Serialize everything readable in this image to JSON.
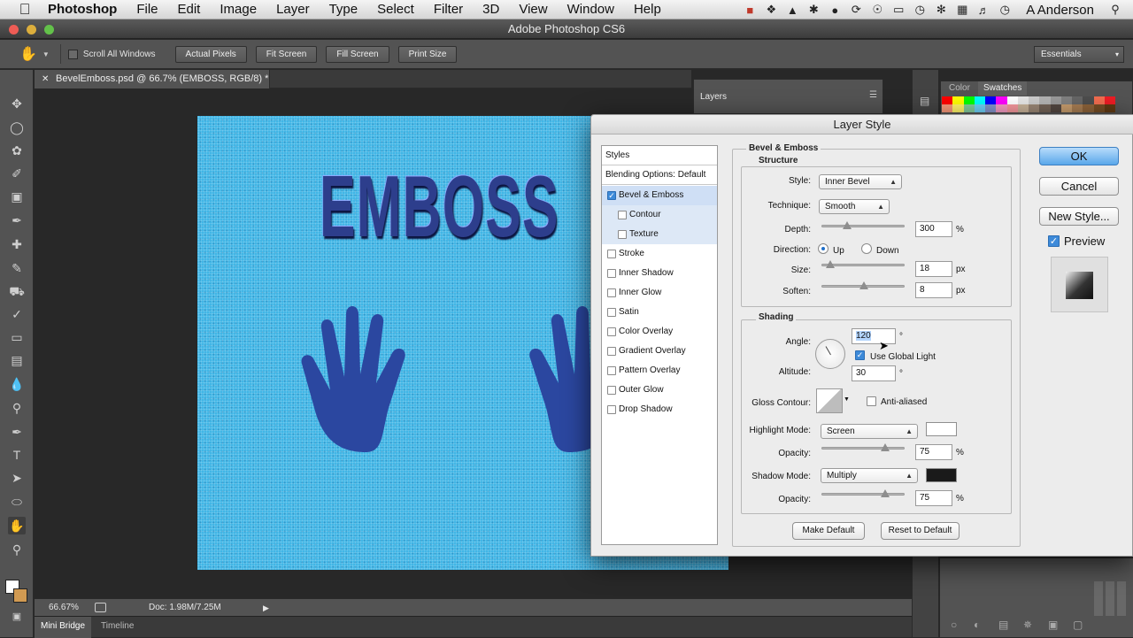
{
  "menubar": {
    "app": "Photoshop",
    "items": [
      "File",
      "Edit",
      "Image",
      "Layer",
      "Type",
      "Select",
      "Filter",
      "3D",
      "View",
      "Window",
      "Help"
    ],
    "user": "A Anderson"
  },
  "titlebar": {
    "title": "Adobe Photoshop CS6"
  },
  "options": {
    "scroll_all": "Scroll All Windows",
    "actual_pixels": "Actual Pixels",
    "fit_screen": "Fit Screen",
    "fill_screen": "Fill Screen",
    "print_size": "Print Size",
    "workspace": "Essentials"
  },
  "document": {
    "tab": "BevelEmboss.psd @ 66.7% (EMBOSS, RGB/8) *",
    "text": "EMBOSS",
    "canvas_color": "#41b6e6",
    "shape_color": "#2b47a0"
  },
  "status": {
    "zoom": "66.67%",
    "doc": "Doc: 1.98M/7.25M"
  },
  "bottom_tabs": [
    "Mini Bridge",
    "Timeline"
  ],
  "panels": {
    "layers": "Layers",
    "color": "Color",
    "swatches": "Swatches"
  },
  "dialog": {
    "title": "Layer Style",
    "styles_header": "Styles",
    "blending": "Blending Options: Default",
    "styles": [
      {
        "label": "Bevel & Emboss",
        "checked": true
      },
      {
        "label": "Contour",
        "checked": false
      },
      {
        "label": "Texture",
        "checked": false
      },
      {
        "label": "Stroke",
        "checked": false
      },
      {
        "label": "Inner Shadow",
        "checked": false
      },
      {
        "label": "Inner Glow",
        "checked": false
      },
      {
        "label": "Satin",
        "checked": false
      },
      {
        "label": "Color Overlay",
        "checked": false
      },
      {
        "label": "Gradient Overlay",
        "checked": false
      },
      {
        "label": "Pattern Overlay",
        "checked": false
      },
      {
        "label": "Outer Glow",
        "checked": false
      },
      {
        "label": "Drop Shadow",
        "checked": false
      }
    ],
    "section": "Bevel & Emboss",
    "structure": {
      "title": "Structure",
      "style_label": "Style:",
      "style_value": "Inner Bevel",
      "technique_label": "Technique:",
      "technique_value": "Smooth",
      "depth_label": "Depth:",
      "depth_value": "300",
      "depth_unit": "%",
      "depth_level": 0.3,
      "direction_label": "Direction:",
      "up": "Up",
      "down": "Down",
      "size_label": "Size:",
      "size_value": "18",
      "size_unit": "px",
      "size_level": 0.1,
      "soften_label": "Soften:",
      "soften_value": "8",
      "soften_unit": "px",
      "soften_level": 0.5
    },
    "shading": {
      "title": "Shading",
      "angle_label": "Angle:",
      "angle_value": "120",
      "angle_unit": "°",
      "global_light": "Use Global Light",
      "altitude_label": "Altitude:",
      "altitude_value": "30",
      "altitude_unit": "°",
      "gloss_label": "Gloss Contour:",
      "anti_aliased": "Anti-aliased",
      "highlight_label": "Highlight Mode:",
      "highlight_value": "Screen",
      "highlight_color": "#ffffff",
      "hl_opacity_label": "Opacity:",
      "hl_opacity_value": "75",
      "hl_opacity_unit": "%",
      "hl_opacity_level": 0.75,
      "shadow_label": "Shadow Mode:",
      "shadow_value": "Multiply",
      "shadow_color": "#1a1a1a",
      "sh_opacity_label": "Opacity:",
      "sh_opacity_value": "75",
      "sh_opacity_unit": "%",
      "sh_opacity_level": 0.75
    },
    "make_default": "Make Default",
    "reset_default": "Reset to Default",
    "ok": "OK",
    "cancel": "Cancel",
    "new_style": "New Style...",
    "preview": "Preview"
  }
}
